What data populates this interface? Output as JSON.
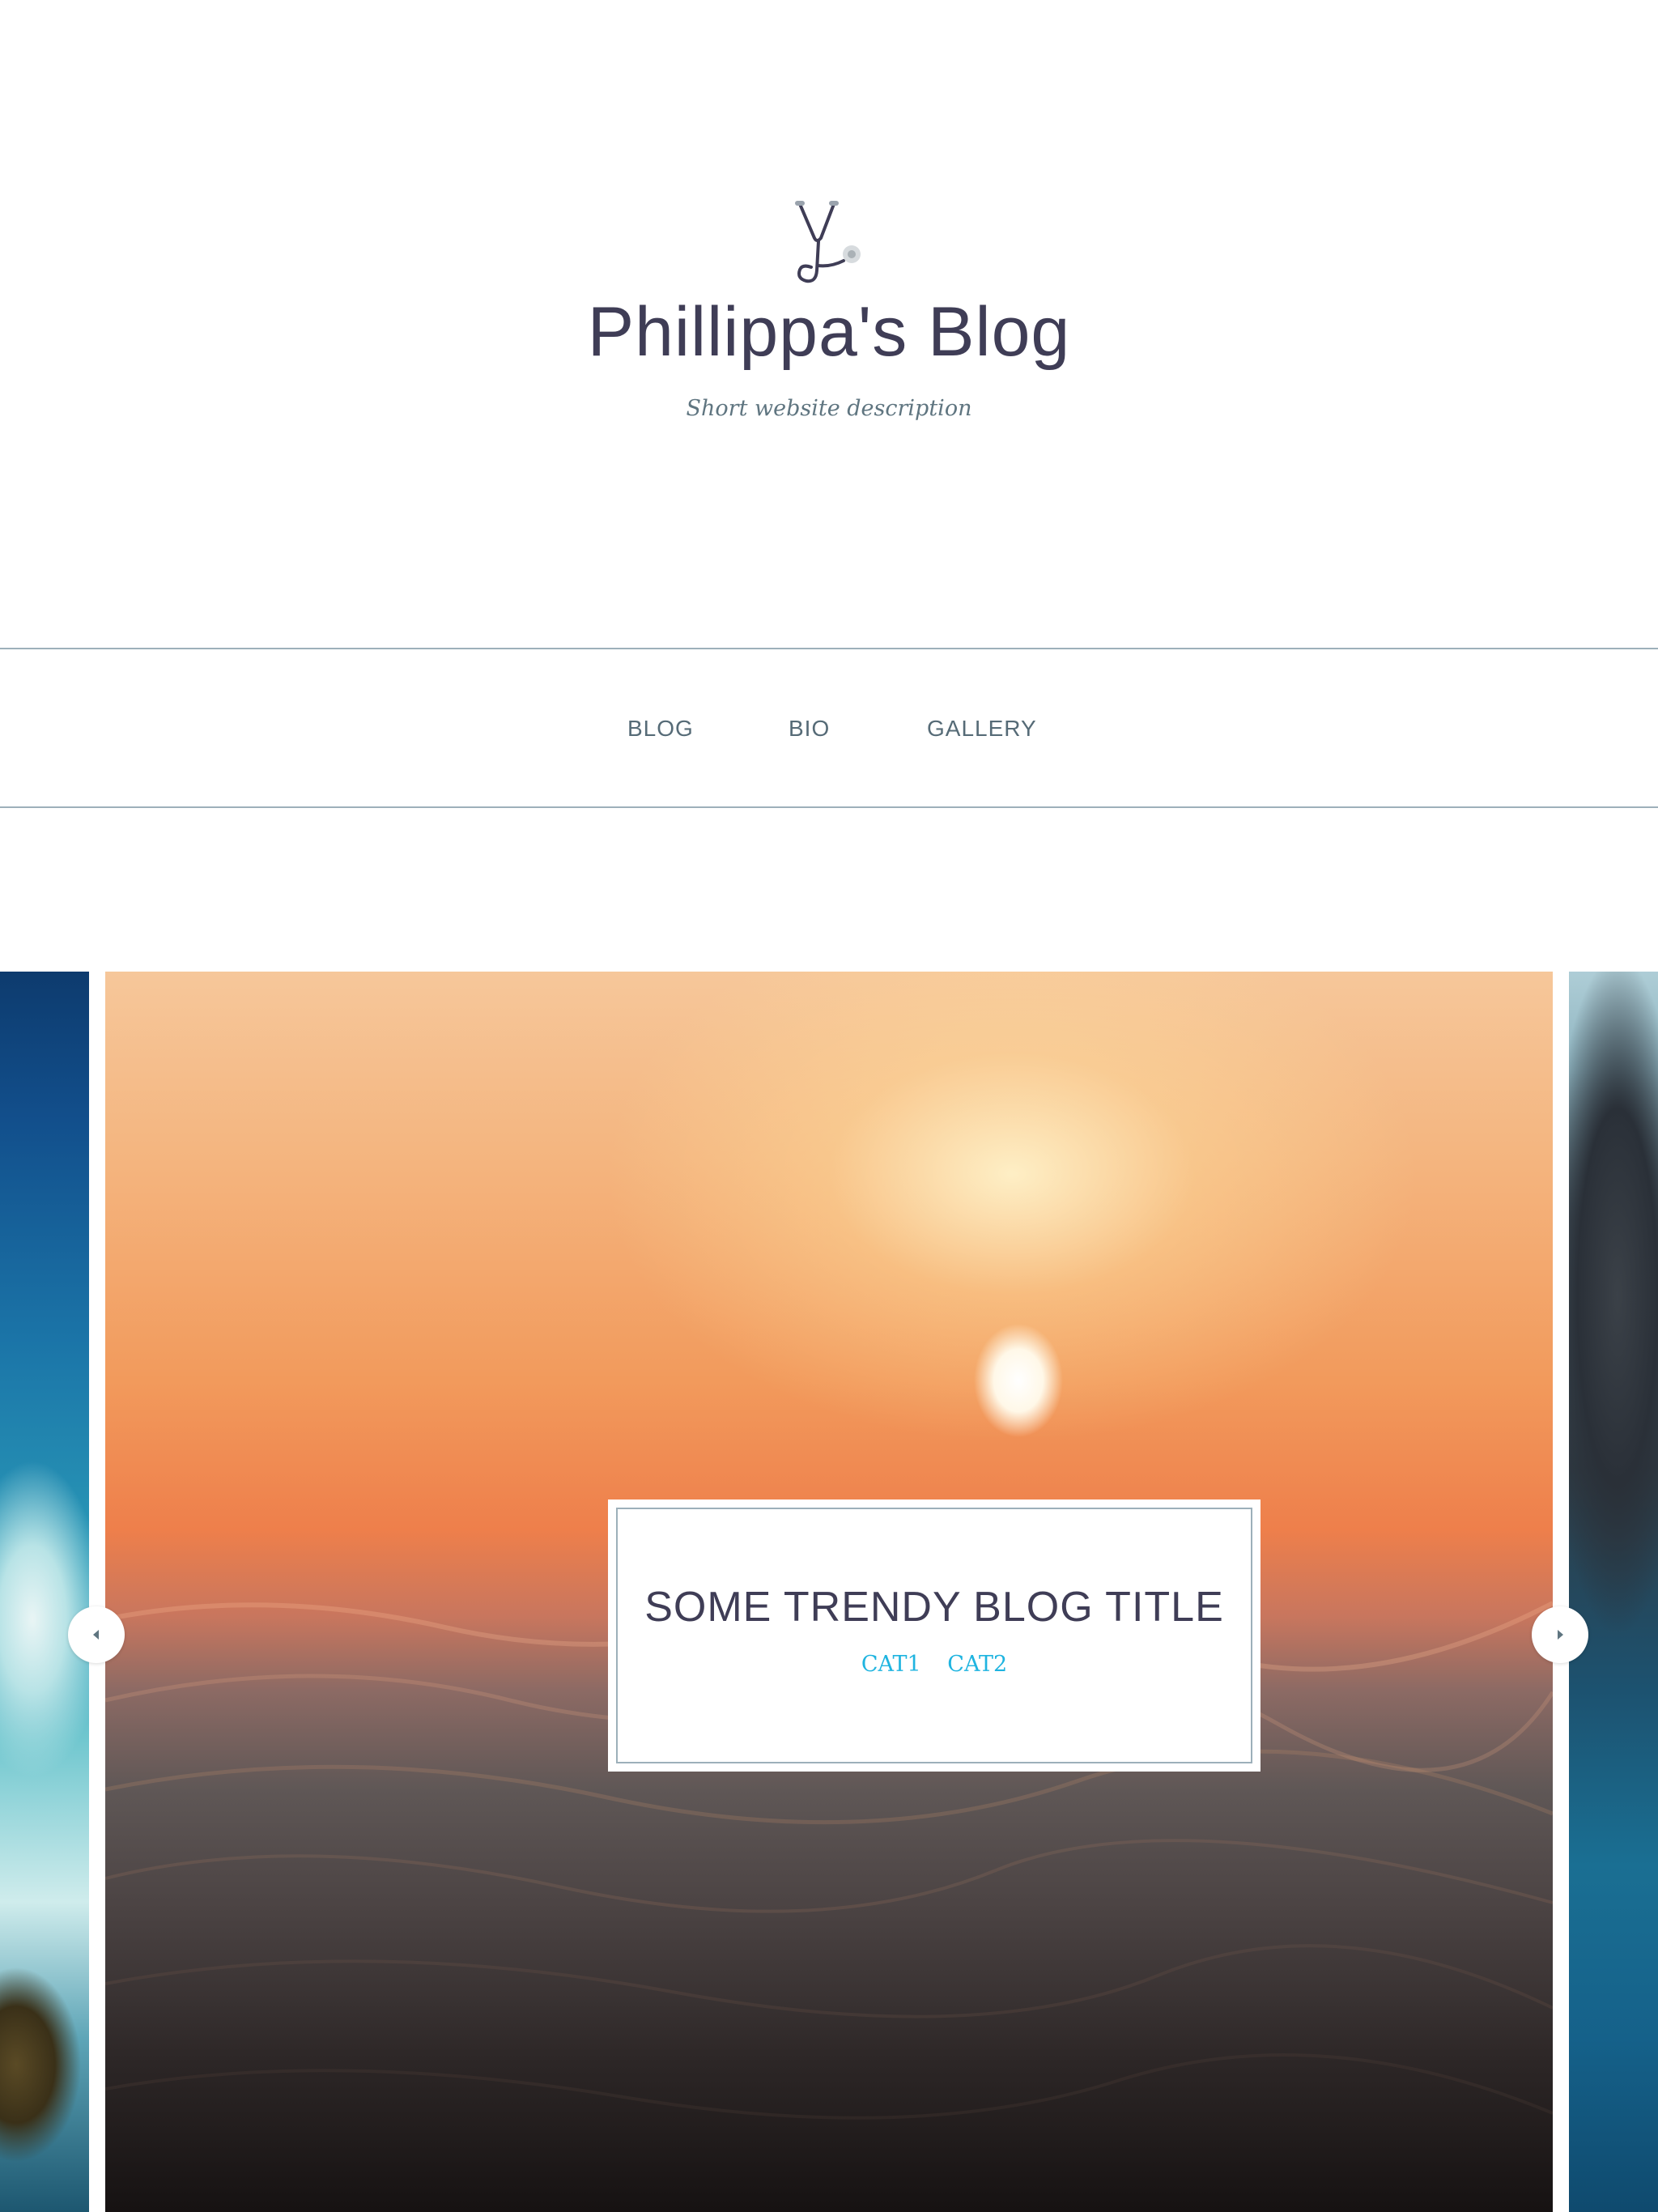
{
  "header": {
    "logo_icon": "stethoscope-icon",
    "title": "Phillippa's Blog",
    "description": "Short website description"
  },
  "nav": {
    "items": [
      {
        "label": "BLOG"
      },
      {
        "label": "BIO"
      },
      {
        "label": "GALLERY"
      }
    ]
  },
  "carousel": {
    "prev_icon": "caret-left-icon",
    "next_icon": "caret-right-icon",
    "featured_post": {
      "title": "SOME TRENDY BLOG TITLE",
      "categories": [
        "CAT1",
        "CAT2"
      ]
    }
  },
  "colors": {
    "text_dark": "#3f3d56",
    "text_muted": "#5f7580",
    "nav_text": "#566b77",
    "rule": "#9db0ba",
    "category_link": "#1fb4e0"
  }
}
